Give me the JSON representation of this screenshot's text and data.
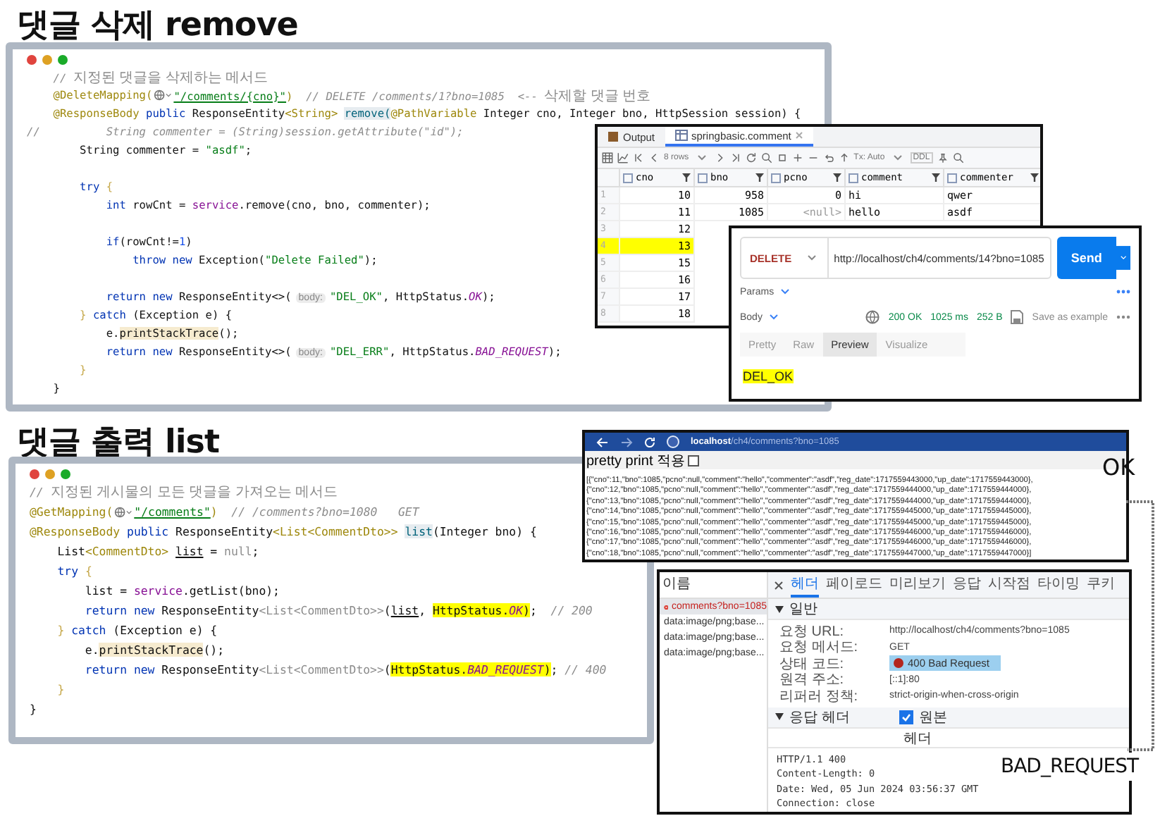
{
  "titles": [
    "댓글 삭제 remove",
    "댓글 출력 list"
  ],
  "code_delete": {
    "lines": [
      {
        "kind": "code",
        "tokens": [
          {
            "text": "    // ",
            "kind": "comment"
          },
          {
            "text": "지정된 댓글을 삭제하는 메서드",
            "kind": "note"
          }
        ]
      },
      {
        "kind": "code",
        "tokens": [
          {
            "text": "    @DeleteMapping(",
            "kind": "ann"
          },
          {
            "kind": "web-icon"
          },
          {
            "text": "\"/comments/{cno}\"",
            "kind": "url"
          },
          {
            "text": ")",
            "kind": "ann"
          },
          {
            "text": "  // DELETE /comments/1?bno=1085  <-- ",
            "kind": "comment"
          },
          {
            "text": "삭제할 댓글 번호",
            "kind": "note"
          }
        ]
      },
      {
        "kind": "code",
        "tokens": [
          {
            "text": "    @ResponseBody",
            "kind": "ann"
          },
          {
            "text": " public ",
            "kind": "kw"
          },
          {
            "text": "ResponseEntity",
            "kind": "plain"
          },
          {
            "text": "<String> ",
            "kind": "ann"
          },
          {
            "text": "remove(",
            "kind": "method"
          },
          {
            "text": "@PathVariable",
            "kind": "ann"
          },
          {
            "text": " Integer cno, Integer bno, HttpSession session) {",
            "kind": "plain"
          }
        ]
      },
      {
        "kind": "code",
        "tokens": [
          {
            "text": "//          String commenter = (String)session.getAttribute(\"id\");",
            "kind": "comment"
          }
        ]
      },
      {
        "kind": "code",
        "tokens": [
          {
            "text": "        String commenter = ",
            "kind": "plain"
          },
          {
            "text": "\"asdf\"",
            "kind": "str"
          },
          {
            "text": ";",
            "kind": "plain"
          }
        ]
      },
      {
        "kind": "blank"
      },
      {
        "kind": "code",
        "tokens": [
          {
            "text": "        try",
            "kind": "kw"
          },
          {
            "text": " {",
            "kind": "brace"
          }
        ]
      },
      {
        "kind": "code",
        "tokens": [
          {
            "text": "            int",
            "kind": "kw"
          },
          {
            "text": " rowCnt = ",
            "kind": "plain"
          },
          {
            "text": "service",
            "kind": "field"
          },
          {
            "text": ".remove(cno, bno, commenter);",
            "kind": "plain"
          }
        ]
      },
      {
        "kind": "blank"
      },
      {
        "kind": "code",
        "tokens": [
          {
            "text": "            if",
            "kind": "kw"
          },
          {
            "text": "(rowCnt!=",
            "kind": "plain"
          },
          {
            "text": "1",
            "kind": "num"
          },
          {
            "text": ")",
            "kind": "plain"
          }
        ]
      },
      {
        "kind": "code",
        "tokens": [
          {
            "text": "                throw new",
            "kind": "kw"
          },
          {
            "text": " Exception(",
            "kind": "plain"
          },
          {
            "text": "\"Delete Failed\"",
            "kind": "str"
          },
          {
            "text": ");",
            "kind": "plain"
          }
        ]
      },
      {
        "kind": "blank"
      },
      {
        "kind": "code",
        "tokens": [
          {
            "text": "            return new",
            "kind": "kw"
          },
          {
            "text": " ResponseEntity<>(",
            "kind": "plain"
          },
          {
            "text": "body:",
            "kind": "hint"
          },
          {
            "text": "\"DEL_OK\"",
            "kind": "str"
          },
          {
            "text": ", HttpStatus.",
            "kind": "plain"
          },
          {
            "text": "OK",
            "kind": "const"
          },
          {
            "text": ");",
            "kind": "plain"
          }
        ]
      },
      {
        "kind": "code",
        "tokens": [
          {
            "text": "        }",
            "kind": "brace"
          },
          {
            "text": " catch",
            "kind": "kw"
          },
          {
            "text": " (Exception e) {",
            "kind": "plain"
          }
        ]
      },
      {
        "kind": "code",
        "tokens": [
          {
            "text": "            e.",
            "kind": "plain"
          },
          {
            "text": "printStackTrace",
            "kind": "soft"
          },
          {
            "text": "();",
            "kind": "plain"
          }
        ]
      },
      {
        "kind": "code",
        "tokens": [
          {
            "text": "            return new",
            "kind": "kw"
          },
          {
            "text": " ResponseEntity<>(",
            "kind": "plain"
          },
          {
            "text": "body:",
            "kind": "hint"
          },
          {
            "text": "\"DEL_ERR\"",
            "kind": "str"
          },
          {
            "text": ", HttpStatus.",
            "kind": "plain"
          },
          {
            "text": "BAD_REQUEST",
            "kind": "const"
          },
          {
            "text": ");",
            "kind": "plain"
          }
        ]
      },
      {
        "kind": "code",
        "tokens": [
          {
            "text": "        }",
            "kind": "brace"
          }
        ]
      },
      {
        "kind": "code",
        "tokens": [
          {
            "text": "    }",
            "kind": "plain"
          }
        ]
      }
    ]
  },
  "db_window": {
    "tabs": [
      {
        "label": "Output",
        "selected": false
      },
      {
        "label": "springbasic.comment",
        "selected": true
      }
    ],
    "rows_count": "8 rows",
    "tx": "Tx: Auto",
    "ddl": "DDL",
    "columns": [
      "cno",
      "bno",
      "pcno",
      "comment",
      "commenter"
    ],
    "rows": [
      {
        "num": "1",
        "highlighted": false,
        "cells": [
          {
            "text": "10",
            "kind": "num"
          },
          {
            "text": "958",
            "kind": "num"
          },
          {
            "text": "0",
            "kind": "num"
          },
          {
            "text": "hi",
            "kind": "text"
          },
          {
            "text": "qwer",
            "kind": "text"
          }
        ]
      },
      {
        "num": "2",
        "highlighted": false,
        "cells": [
          {
            "text": "11",
            "kind": "num"
          },
          {
            "text": "1085",
            "kind": "num"
          },
          {
            "text": "<null>",
            "kind": "null"
          },
          {
            "text": "hello",
            "kind": "text"
          },
          {
            "text": "asdf",
            "kind": "text"
          }
        ]
      },
      {
        "num": "3",
        "highlighted": false,
        "cells": [
          {
            "text": "12",
            "kind": "num"
          }
        ]
      },
      {
        "num": "4",
        "highlighted": true,
        "cells": [
          {
            "text": "13",
            "kind": "num"
          }
        ]
      },
      {
        "num": "5",
        "highlighted": false,
        "cells": [
          {
            "text": "15",
            "kind": "num"
          }
        ]
      },
      {
        "num": "6",
        "highlighted": false,
        "cells": [
          {
            "text": "16",
            "kind": "num"
          }
        ]
      },
      {
        "num": "7",
        "highlighted": false,
        "cells": [
          {
            "text": "17",
            "kind": "num"
          }
        ]
      },
      {
        "num": "8",
        "highlighted": false,
        "cells": [
          {
            "text": "18",
            "kind": "num"
          }
        ]
      }
    ]
  },
  "request": {
    "method": "DELETE",
    "url": "http://localhost/ch4/comments/14?bno=1085",
    "send": "Send",
    "params": "Params",
    "body": "Body",
    "status": "200 OK",
    "time": "1025 ms",
    "size": "252 B",
    "save": "Save as example",
    "tabs": [
      {
        "label": "Pretty",
        "selected": false
      },
      {
        "label": "Raw",
        "selected": false
      },
      {
        "label": "Preview",
        "selected": true
      },
      {
        "label": "Visualize",
        "selected": false
      }
    ],
    "response": "DEL_OK"
  },
  "code_list": {
    "lines": [
      {
        "kind": "code",
        "tokens": [
          {
            "text": "// ",
            "kind": "comment"
          },
          {
            "text": "지정된 게시물의 모든 댓글을 가져오는 메서드",
            "kind": "note"
          }
        ]
      },
      {
        "kind": "code",
        "tokens": [
          {
            "text": "@GetMapping(",
            "kind": "ann"
          },
          {
            "kind": "web-icon"
          },
          {
            "text": "\"/comments\"",
            "kind": "url"
          },
          {
            "text": ")",
            "kind": "ann"
          },
          {
            "text": "  // /comments?bno=1080   GET",
            "kind": "comment"
          }
        ]
      },
      {
        "kind": "code",
        "tokens": [
          {
            "text": "@ResponseBody",
            "kind": "ann"
          },
          {
            "text": " public ",
            "kind": "kw"
          },
          {
            "text": "ResponseEntity",
            "kind": "plain"
          },
          {
            "text": "<List<CommentDto>> ",
            "kind": "ann"
          },
          {
            "text": "list",
            "kind": "method"
          },
          {
            "text": "(Integer bno) {",
            "kind": "plain"
          }
        ]
      },
      {
        "kind": "code",
        "tokens": [
          {
            "text": "    List",
            "kind": "plain"
          },
          {
            "text": "<CommentDto> ",
            "kind": "ann"
          },
          {
            "text": "list",
            "kind": "under"
          },
          {
            "text": " = ",
            "kind": "plain"
          },
          {
            "text": "null",
            "kind": "gray"
          },
          {
            "text": ";",
            "kind": "plain"
          }
        ]
      },
      {
        "kind": "code",
        "tokens": [
          {
            "text": "    try",
            "kind": "kw"
          },
          {
            "text": " {",
            "kind": "brace"
          }
        ]
      },
      {
        "kind": "code",
        "tokens": [
          {
            "text": "        list = ",
            "kind": "plain"
          },
          {
            "text": "service",
            "kind": "field"
          },
          {
            "text": ".getList(bno);",
            "kind": "plain"
          }
        ]
      },
      {
        "kind": "code",
        "tokens": [
          {
            "text": "        return new",
            "kind": "kw"
          },
          {
            "text": " ResponseEntity",
            "kind": "plain"
          },
          {
            "text": "<List<CommentDto>>",
            "kind": "gray"
          },
          {
            "text": "(",
            "kind": "plain"
          },
          {
            "text": "list",
            "kind": "under"
          },
          {
            "text": ", ",
            "kind": "plain"
          },
          {
            "text": "HttpStatus.",
            "kind": "marked"
          },
          {
            "text": "OK",
            "kind": "marked-const"
          },
          {
            "text": ")",
            "kind": "marked"
          },
          {
            "text": ";",
            "kind": "plain"
          },
          {
            "text": "  // 200",
            "kind": "comment"
          }
        ]
      },
      {
        "kind": "code",
        "tokens": [
          {
            "text": "    }",
            "kind": "brace"
          },
          {
            "text": " catch",
            "kind": "kw"
          },
          {
            "text": " (Exception e) {",
            "kind": "plain"
          }
        ]
      },
      {
        "kind": "code",
        "tokens": [
          {
            "text": "        e.",
            "kind": "plain"
          },
          {
            "text": "printStackTrace",
            "kind": "soft"
          },
          {
            "text": "();",
            "kind": "plain"
          }
        ]
      },
      {
        "kind": "code",
        "tokens": [
          {
            "text": "        return new",
            "kind": "kw"
          },
          {
            "text": " ResponseEntity",
            "kind": "plain"
          },
          {
            "text": "<List<CommentDto>>",
            "kind": "gray"
          },
          {
            "text": "(",
            "kind": "plain"
          },
          {
            "text": "HttpStatus.",
            "kind": "marked"
          },
          {
            "text": "BAD_REQUEST",
            "kind": "marked-const"
          },
          {
            "text": ")",
            "kind": "marked"
          },
          {
            "text": ";",
            "kind": "plain"
          },
          {
            "text": " // 400",
            "kind": "comment"
          }
        ]
      },
      {
        "kind": "code",
        "tokens": [
          {
            "text": "    }",
            "kind": "brace"
          }
        ]
      },
      {
        "kind": "code",
        "tokens": [
          {
            "text": "}",
            "kind": "plain"
          }
        ]
      }
    ]
  },
  "browser": {
    "host": "localhost",
    "path": "/ch4/comments?bno=1085",
    "pretty_print": "pretty print 적용",
    "pretty_checked": false,
    "json_lines": [
      "[{\"cno\":11,\"bno\":1085,\"pcno\":null,\"comment\":\"hello\",\"commenter\":\"asdf\",\"reg_date\":1717559443000,\"up_date\":1717559443000},",
      "{\"cno\":12,\"bno\":1085,\"pcno\":null,\"comment\":\"hello\",\"commenter\":\"asdf\",\"reg_date\":1717559444000,\"up_date\":1717559444000},",
      "{\"cno\":13,\"bno\":1085,\"pcno\":null,\"comment\":\"hello\",\"commenter\":\"asdf\",\"reg_date\":1717559444000,\"up_date\":1717559444000},",
      "{\"cno\":14,\"bno\":1085,\"pcno\":null,\"comment\":\"hello\",\"commenter\":\"asdf\",\"reg_date\":1717559445000,\"up_date\":1717559445000},",
      "{\"cno\":15,\"bno\":1085,\"pcno\":null,\"comment\":\"hello\",\"commenter\":\"asdf\",\"reg_date\":1717559445000,\"up_date\":1717559445000},",
      "{\"cno\":16,\"bno\":1085,\"pcno\":null,\"comment\":\"hello\",\"commenter\":\"asdf\",\"reg_date\":1717559446000,\"up_date\":1717559446000},",
      "{\"cno\":17,\"bno\":1085,\"pcno\":null,\"comment\":\"hello\",\"commenter\":\"asdf\",\"reg_date\":1717559446000,\"up_date\":1717559446000},",
      "{\"cno\":18,\"bno\":1085,\"pcno\":null,\"comment\":\"hello\",\"commenter\":\"asdf\",\"reg_date\":1717559447000,\"up_date\":1717559447000}]"
    ]
  },
  "devtools": {
    "name_header": "이름",
    "requests": [
      {
        "name": "comments?bno=1085",
        "error": true,
        "selected": true
      },
      {
        "name": "data:image/png;base...",
        "error": false,
        "selected": false
      },
      {
        "name": "data:image/png;base...",
        "error": false,
        "selected": false
      },
      {
        "name": "data:image/png;base...",
        "error": false,
        "selected": false
      }
    ],
    "tabs": [
      {
        "label": "헤더",
        "selected": true
      },
      {
        "label": "페이로드",
        "selected": false
      },
      {
        "label": "미리보기",
        "selected": false
      },
      {
        "label": "응답",
        "selected": false
      },
      {
        "label": "시작점",
        "selected": false
      },
      {
        "label": "타이밍",
        "selected": false
      },
      {
        "label": "쿠키",
        "selected": false
      }
    ],
    "general": "일반",
    "fields": [
      {
        "label": "요청 URL:",
        "value": "http://localhost/ch4/comments?bno=1085",
        "kind": "text"
      },
      {
        "label": "요청 메서드:",
        "value": "GET",
        "kind": "text"
      },
      {
        "label": "상태 코드:",
        "value": "400 Bad Request",
        "kind": "status"
      },
      {
        "label": "원격 주소:",
        "value": "[::1]:80",
        "kind": "text"
      },
      {
        "label": "리퍼러 정책:",
        "value": "strict-origin-when-cross-origin",
        "kind": "text"
      }
    ],
    "response_headers": "응답 헤더",
    "raw_label": "원본",
    "raw_checked": true,
    "header_label": "헤더",
    "raw_lines": [
      "HTTP/1.1 400",
      "Content-Length: 0",
      "Date: Wed, 05 Jun 2024 03:56:37 GMT",
      "Connection: close"
    ]
  },
  "notes": [
    "OK",
    "BAD_REQUEST"
  ]
}
